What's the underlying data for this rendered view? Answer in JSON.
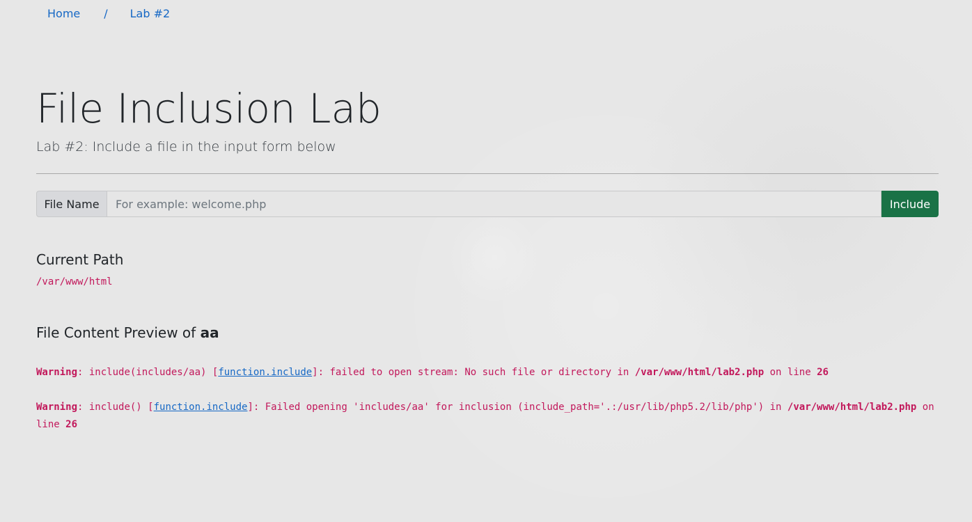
{
  "breadcrumb": {
    "home": "Home",
    "separator": "/",
    "current": "Lab #2"
  },
  "page": {
    "title": "File Inclusion Lab",
    "lead": "Lab #2: Include a file in the input form below"
  },
  "form": {
    "label": "File Name",
    "placeholder": "For example: welcome.php",
    "value": "",
    "button": "Include"
  },
  "current_path": {
    "heading": "Current Path",
    "value": "/var/www/html"
  },
  "preview": {
    "heading_prefix": "File Content Preview of",
    "file_name": "aa"
  },
  "warnings": [
    {
      "label": "Warning",
      "before": ": include(includes/aa) [",
      "link": "function.include",
      "after": "]: failed to open stream: No such file or directory in ",
      "file": "/var/www/html/lab2.php",
      "on_line": " on line ",
      "line": "26"
    },
    {
      "label": "Warning",
      "before": ": include() [",
      "link": "function.include",
      "after": "]: Failed opening 'includes/aa' for inclusion (include_path='.:/usr/lib/php5.2/lib/php') in ",
      "file": "/var/www/html/lab2.php",
      "on_line": " on line ",
      "line": "26"
    }
  ],
  "colors": {
    "link": "#1668c5",
    "code": "#c2185b",
    "button": "#1a7246",
    "background": "#e7e7e7"
  }
}
